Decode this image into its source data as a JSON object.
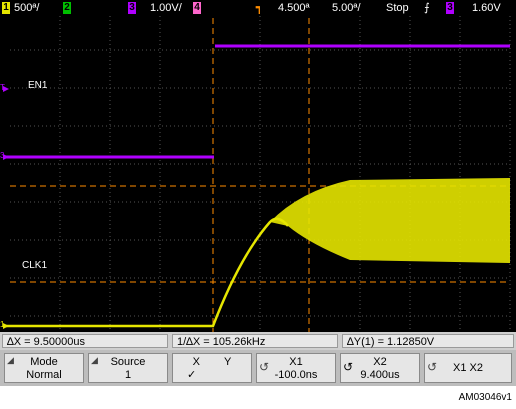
{
  "status_bar": {
    "ch1_num": "1",
    "ch1_scale": "500ª/",
    "ch2_num": "2",
    "ch3_num": "3",
    "ch3_scale": "1.00V/",
    "ch4_num": "4",
    "trigger_icon": "trigger-marker-icon",
    "time_delay": "4.500ª",
    "time_scale": "5.00ª/",
    "run_state": "Stop",
    "slope_icon": "rising-edge-icon",
    "trig_source": "3",
    "trig_level": "1.60V"
  },
  "screen": {
    "label_en1": "EN1",
    "label_clk1": "CLK1",
    "marker_ch3": "3",
    "marker_ch1": "1",
    "marker_trig": "T"
  },
  "measurements": {
    "delta_x": "∆X = 9.50000us",
    "inv_delta_x": "1/∆X = 105.26kHz",
    "delta_y": "∆Y(1) = 1.12850V"
  },
  "softkeys": {
    "mode_label": "Mode",
    "mode_value": "Normal",
    "source_label": "Source",
    "source_value": "1",
    "x_label": "X",
    "y_label": "Y",
    "x_check": "✓",
    "x1_label": "X1",
    "x1_value": "-100.0ns",
    "x2_label": "X2",
    "x2_value": "9.400us",
    "x1x2_label": "X1 X2"
  },
  "caption": "AM03046v1",
  "colors": {
    "ch1": "#e6e600",
    "ch3": "#b000ff",
    "cursor": "#ff8c00",
    "screen": "#000000"
  }
}
